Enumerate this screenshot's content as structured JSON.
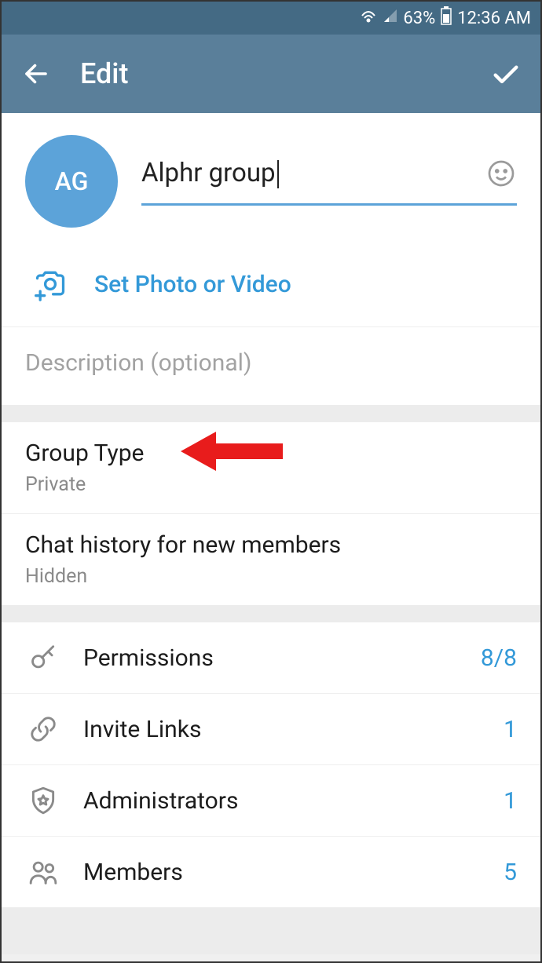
{
  "statusbar": {
    "battery_pct": "63%",
    "time": "12:36 AM"
  },
  "header": {
    "title": "Edit"
  },
  "profile": {
    "avatar_initials": "AG",
    "name_value": "Alphr group",
    "set_photo_label": "Set Photo or Video",
    "description_placeholder": "Description (optional)"
  },
  "settings": {
    "group_type": {
      "label": "Group Type",
      "value": "Private"
    },
    "chat_history": {
      "label": "Chat history for new members",
      "value": "Hidden"
    }
  },
  "rows": {
    "permissions": {
      "label": "Permissions",
      "value": "8/8"
    },
    "invite_links": {
      "label": "Invite Links",
      "value": "1"
    },
    "administrators": {
      "label": "Administrators",
      "value": "1"
    },
    "members": {
      "label": "Members",
      "value": "5"
    }
  }
}
